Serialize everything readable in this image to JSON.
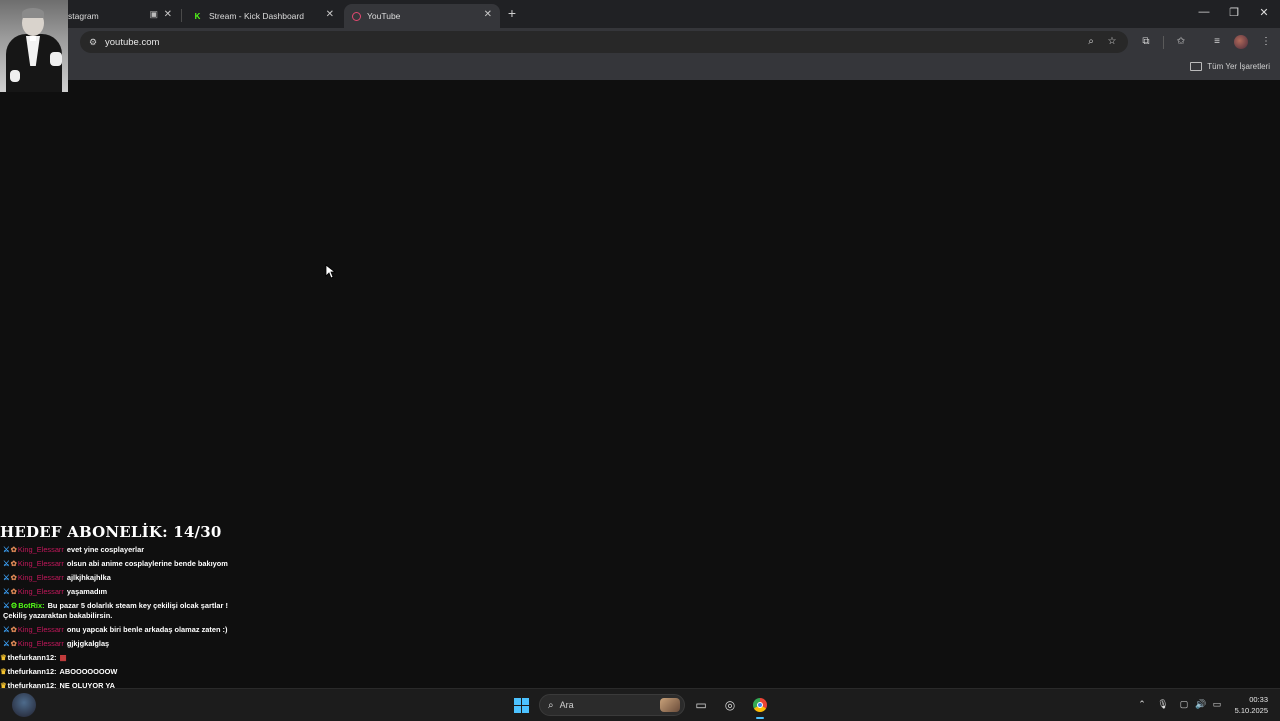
{
  "browser": {
    "tabs": [
      {
        "title": "stagram",
        "active": false
      },
      {
        "title": "Stream - Kick Dashboard",
        "active": false
      },
      {
        "title": "YouTube",
        "active": true
      }
    ],
    "new_tab": "+",
    "url": "youtube.com",
    "bookmarks_all": "Tüm Yer İşaretleri",
    "window_controls": {
      "minimize": "—",
      "restore": "❐",
      "close": "✕"
    }
  },
  "overlay": {
    "goal_text": "HEDEF ABONELİK: 14/30",
    "chat": [
      {
        "user": "King_Elessarr",
        "text": "evet yine cosplayerlar",
        "kind": "viewer"
      },
      {
        "user": "King_Elessarr",
        "text": "olsun abi anime cosplaylerine bende bakıyom",
        "kind": "viewer"
      },
      {
        "user": "King_Elessarr",
        "text": "ajlkjhkajhlka",
        "kind": "viewer"
      },
      {
        "user": "King_Elessarr",
        "text": "yaşamadım",
        "kind": "viewer"
      },
      {
        "user": "BotRix:",
        "text": "Bu pazar 5 dolarlık steam key çekilişi olcak şartlar !Çekiliş yazaraktan bakabilirsin.",
        "kind": "bot"
      },
      {
        "user": "King_Elessarr",
        "text": "onu yapcak biri benle arkadaş olamaz zaten :)",
        "kind": "viewer"
      },
      {
        "user": "King_Elessarr",
        "text": "gjkjgkalglaş",
        "kind": "viewer"
      },
      {
        "user": "thefurkann12:",
        "text": "▦",
        "kind": "owner"
      },
      {
        "user": "thefurkann12:",
        "text": "ABOOOOOOOW",
        "kind": "owner"
      },
      {
        "user": "thefurkann12:",
        "text": "NE OLUYOR YA",
        "kind": "owner"
      }
    ]
  },
  "taskbar": {
    "search_placeholder": "Ara",
    "time": "00:33",
    "date": "5.10.2025"
  },
  "colors": {
    "accent": "#4cc2ff",
    "kick_green": "#53fc18",
    "chat_user": "#c2185b"
  }
}
